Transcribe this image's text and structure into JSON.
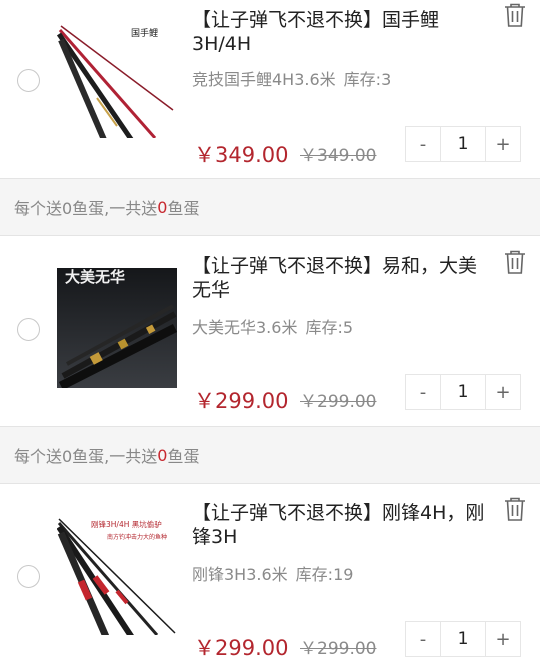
{
  "cart_items": [
    {
      "title": "【让子弹飞不退不换】国手鲤3H/4H",
      "spec": "竞技国手鲤4H3.6米",
      "stock": "库存:3",
      "price": "￥349.00",
      "original_price": "￥349.00",
      "quantity": "1",
      "image_caption": "国手鲤",
      "image": "fishing-rods-red-black"
    },
    {
      "title": "【让子弹飞不退不换】易和，大美无华",
      "spec": "大美无华3.6米",
      "stock": "库存:5",
      "price": "￥299.00",
      "original_price": "￥299.00",
      "quantity": "1",
      "image_caption": "大美无华",
      "image": "fishing-rod-dark-night"
    },
    {
      "title": "【让子弹飞不退不换】刚锋4H，刚锋3H",
      "spec": "刚锋3H3.6米",
      "stock": "库存:19",
      "price": "￥299.00",
      "original_price": "￥299.00",
      "quantity": "1",
      "image_caption": "刚锋3H/4H 黑坑偷驴",
      "image_subcaption": "南方钓冲击力大的鱼种",
      "image": "fishing-rods-red-black-bands"
    }
  ],
  "promos": [
    {
      "prefix": "每个送0鱼蛋,一共送",
      "count": "0",
      "suffix": "鱼蛋"
    },
    {
      "prefix": "每个送0鱼蛋,一共送",
      "count": "0",
      "suffix": "鱼蛋"
    }
  ],
  "stepper": {
    "minus": "-",
    "plus": "+"
  },
  "colors": {
    "price": "#b3262e",
    "highlight": "#c7282f",
    "promo_bg": "#f5f5f5"
  }
}
